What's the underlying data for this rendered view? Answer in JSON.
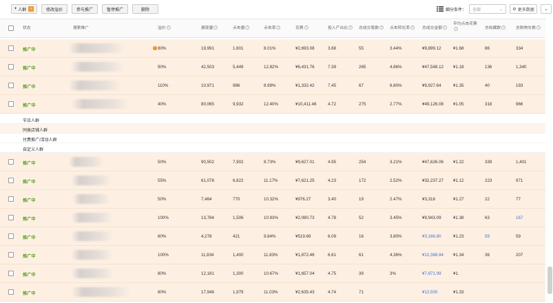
{
  "toolbar": {
    "buttons": [
      {
        "label": "人群",
        "kind": "add"
      },
      {
        "label": "修改溢价"
      },
      {
        "label": "参与推广"
      },
      {
        "label": "暂停推广"
      },
      {
        "label": "删除"
      }
    ],
    "add_mark": "»",
    "filter_label": "细分条件：",
    "filter_value": "全部",
    "more_label": "更多数据"
  },
  "columns": [
    "状态",
    "搜索推广",
    "溢价",
    "展现量",
    "点击量",
    "点击率",
    "花费",
    "投入产出比",
    "总成交笔数",
    "点击转化率",
    "总成交金额",
    "平均点击花费",
    "总收藏数",
    "总购物车数"
  ],
  "rows_top": [
    {
      "status": "推广中",
      "premium": "80%",
      "warn": true,
      "impressions": "19,991",
      "clicks": "1,601",
      "ctr": "8.01%",
      "cost": "¥2,693.08",
      "roi": "3.68",
      "orders": "55",
      "cvr": "3.44%",
      "gmv": "¥9,899.12",
      "cpc": "¥1.68",
      "fav": "86",
      "cart": "334"
    },
    {
      "status": "推广中",
      "premium": "90%",
      "warn": false,
      "impressions": "42,503",
      "clicks": "5,449",
      "ctr": "12.82%",
      "cost": "¥6,431.76",
      "roi": "7.39",
      "orders": "265",
      "cvr": "4.86%",
      "gmv": "¥47,548.12",
      "cpc": "¥1.18",
      "fav": "136",
      "cart": "1,340"
    },
    {
      "status": "推广中",
      "premium": "110%",
      "warn": false,
      "impressions": "10,971",
      "clicks": "986",
      "ctr": "8.99%",
      "cost": "¥1,332.42",
      "roi": "7.45",
      "orders": "67",
      "cvr": "6.80%",
      "gmv": "¥9,927.64",
      "cpc": "¥1.35",
      "fav": "40",
      "cart": "193"
    },
    {
      "status": "推广中",
      "premium": "40%",
      "warn": false,
      "impressions": "80,065",
      "clicks": "9,932",
      "ctr": "12.40%",
      "cost": "¥10,411.46",
      "roi": "4.72",
      "orders": "275",
      "cvr": "2.77%",
      "gmv": "¥49,126.08",
      "cpc": "¥1.05",
      "fav": "318",
      "cart": "966"
    }
  ],
  "groups": [
    "节日人群",
    "同类店铺人群",
    "付费推广/活动人群",
    "自定义人群"
  ],
  "rows_bottom": [
    {
      "status": "推广中",
      "premium": "50%",
      "impressions": "90,502",
      "clicks": "7,902",
      "ctr": "8.73%",
      "cost": "¥9,627.01",
      "roi": "4.95",
      "orders": "254",
      "cvr": "3.21%",
      "gmv": "¥47,626.06",
      "cpc": "¥1.22",
      "fav": "339",
      "cart": "1,401",
      "gmv_blue": false,
      "fav_blue": false,
      "cart_blue": false
    },
    {
      "status": "推广中",
      "premium": "55%",
      "impressions": "61,078",
      "clicks": "6,822",
      "ctr": "11.17%",
      "cost": "¥7,621.25",
      "roi": "4.23",
      "orders": "172",
      "cvr": "2.52%",
      "gmv": "¥32,237.27",
      "cpc": "¥1.12",
      "fav": "223",
      "cart": "971",
      "gmv_blue": false,
      "fav_blue": false,
      "cart_blue": false
    },
    {
      "status": "推广中",
      "premium": "50%",
      "impressions": "7,464",
      "clicks": "770",
      "ctr": "10.32%",
      "cost": "¥976.27",
      "roi": "3.40",
      "orders": "19",
      "cvr": "2.47%",
      "gmv": "¥3,318",
      "cpc": "¥1.27",
      "fav": "22",
      "cart": "77",
      "gmv_blue": false,
      "fav_blue": false,
      "cart_blue": false
    },
    {
      "status": "推广中",
      "premium": "100%",
      "impressions": "13,784",
      "clicks": "1,506",
      "ctr": "10.93%",
      "cost": "¥2,080.73",
      "roi": "4.78",
      "orders": "52",
      "cvr": "3.45%",
      "gmv": "¥9,943.09",
      "cpc": "¥1.38",
      "fav": "63",
      "cart": "167",
      "gmv_blue": false,
      "fav_blue": false,
      "cart_blue": true
    },
    {
      "status": "推广中",
      "premium": "60%",
      "impressions": "4,278",
      "clicks": "421",
      "ctr": "9.84%",
      "cost": "¥519.69",
      "roi": "6.09",
      "orders": "16",
      "cvr": "3.80%",
      "gmv": "¥3,166.80",
      "cpc": "¥1.23",
      "fav": "59",
      "cart": "59",
      "gmv_blue": true,
      "fav_blue": true,
      "cart_blue": false
    },
    {
      "status": "推广中",
      "premium": "100%",
      "impressions": "11,834",
      "clicks": "1,400",
      "ctr": "11.83%",
      "cost": "¥1,872.46",
      "roi": "6.61",
      "orders": "61",
      "cvr": "4.36%",
      "gmv": "¥12,388.84",
      "cpc": "¥1.34",
      "fav": "36",
      "cart": "207",
      "gmv_blue": true,
      "fav_blue": false,
      "cart_blue": false
    },
    {
      "status": "推广中",
      "premium": "80%",
      "impressions": "12,181",
      "clicks": "1,300",
      "ctr": "10.67%",
      "cost": "¥1,657.04",
      "roi": "4.75",
      "orders": "39",
      "cvr": "3%",
      "gmv": "¥7,871.99",
      "cpc": "¥1.",
      "fav": "",
      "cart": "",
      "gmv_blue": true,
      "fav_blue": false,
      "cart_blue": false
    },
    {
      "status": "推广中",
      "premium": "80%",
      "impressions": "17,946",
      "clicks": "1,979",
      "ctr": "11.03%",
      "cost": "¥2,635.43",
      "roi": "4.74",
      "orders": "71",
      "cvr": "",
      "gmv": "¥12,500",
      "cpc": "¥1.33",
      "fav": "",
      "cart": "",
      "gmv_blue": true,
      "fav_blue": false,
      "cart_blue": false
    }
  ],
  "colors": {
    "row_bg": "#fdf0e3",
    "status": "#5b9c1c",
    "warn": "#f08a1a",
    "blurred_link": "#3f6fd4"
  }
}
